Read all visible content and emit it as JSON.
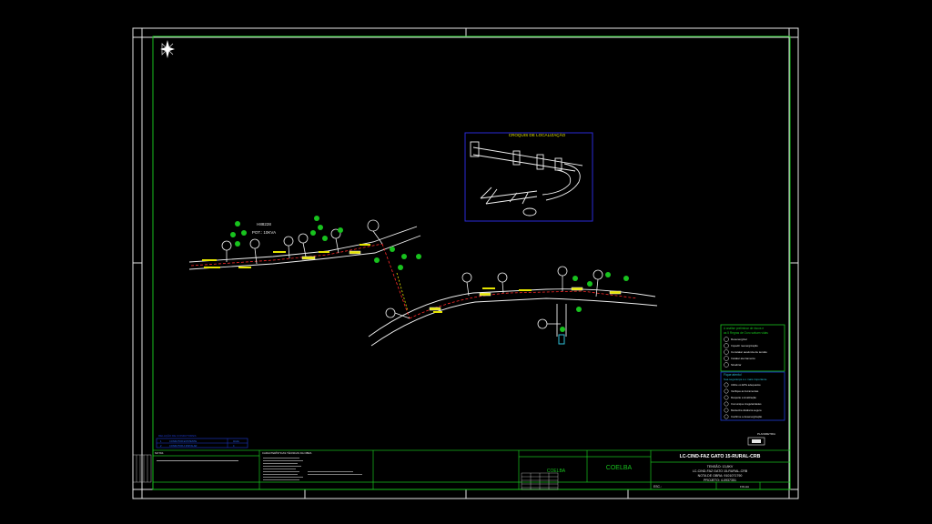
{
  "croqui": {
    "title": "CROQUIS DE LOCALIZAÇÃO"
  },
  "plan": {
    "station_id": "H88228",
    "station_power": "POT.: 10KVA"
  },
  "notes_green": {
    "header_line1": "A análise preliminar de riscos e",
    "header_line2": "as 5 Regras de Ouro salvam vidas",
    "rules": [
      "Desenergizar",
      "Impedir reenergização",
      "Constatar ausência de tensão",
      "Instalar aterramento",
      "Sinalizar"
    ]
  },
  "notes_blue": {
    "header": "Fique atento!",
    "subheader": "Sua segurança é o mais importante",
    "items": [
      "Utilize os EPIs adequados",
      "Verifique as ferramentas",
      "Respeite a sinalização",
      "Comunique irregularidades",
      "Mantenha distância segura",
      "Confirme a desenergização"
    ]
  },
  "legend_blue": {
    "title": "RELAÇÃO DE CONDUTORES",
    "rows": [
      {
        "code": "1",
        "name": "CONDUTOR EXISTENTE",
        "value": "4CAA"
      },
      {
        "code": "2",
        "name": "CONDUTOR A INSTALAR",
        "value": "4"
      }
    ]
  },
  "planimetry_label": "PLANIMETRIA",
  "title_block": {
    "title": "LC-CIND-FAZ GATO 15-RURAL-CRB",
    "tension": "TENSÃO: 13,8KV",
    "project_ref": "LC-CIND-FAZ GATO 15-RURAL-CRB",
    "work_note": "NOTA DE OBRA: 9101071790",
    "project": "PROJETO: 4-0937351",
    "logo_small": "COELBA",
    "logo_large": "COELBA",
    "scale_label": "ESC.:",
    "sheet_label": "FOLHA"
  },
  "tech_box": {
    "title": "CARACTERÍSTICAS TÉCNICAS DA OBRA"
  },
  "notes_box": {
    "title": "NOTAS"
  },
  "colors": {
    "cad_green": "#18c21e",
    "frame_white": "#e6e6e6",
    "croqui_blue": "#2a2ad8",
    "legend_blue": "#1e3bd6",
    "road_white": "#f0f0f0",
    "line_red": "#ff2a2a",
    "label_yellow": "#e6e600"
  }
}
